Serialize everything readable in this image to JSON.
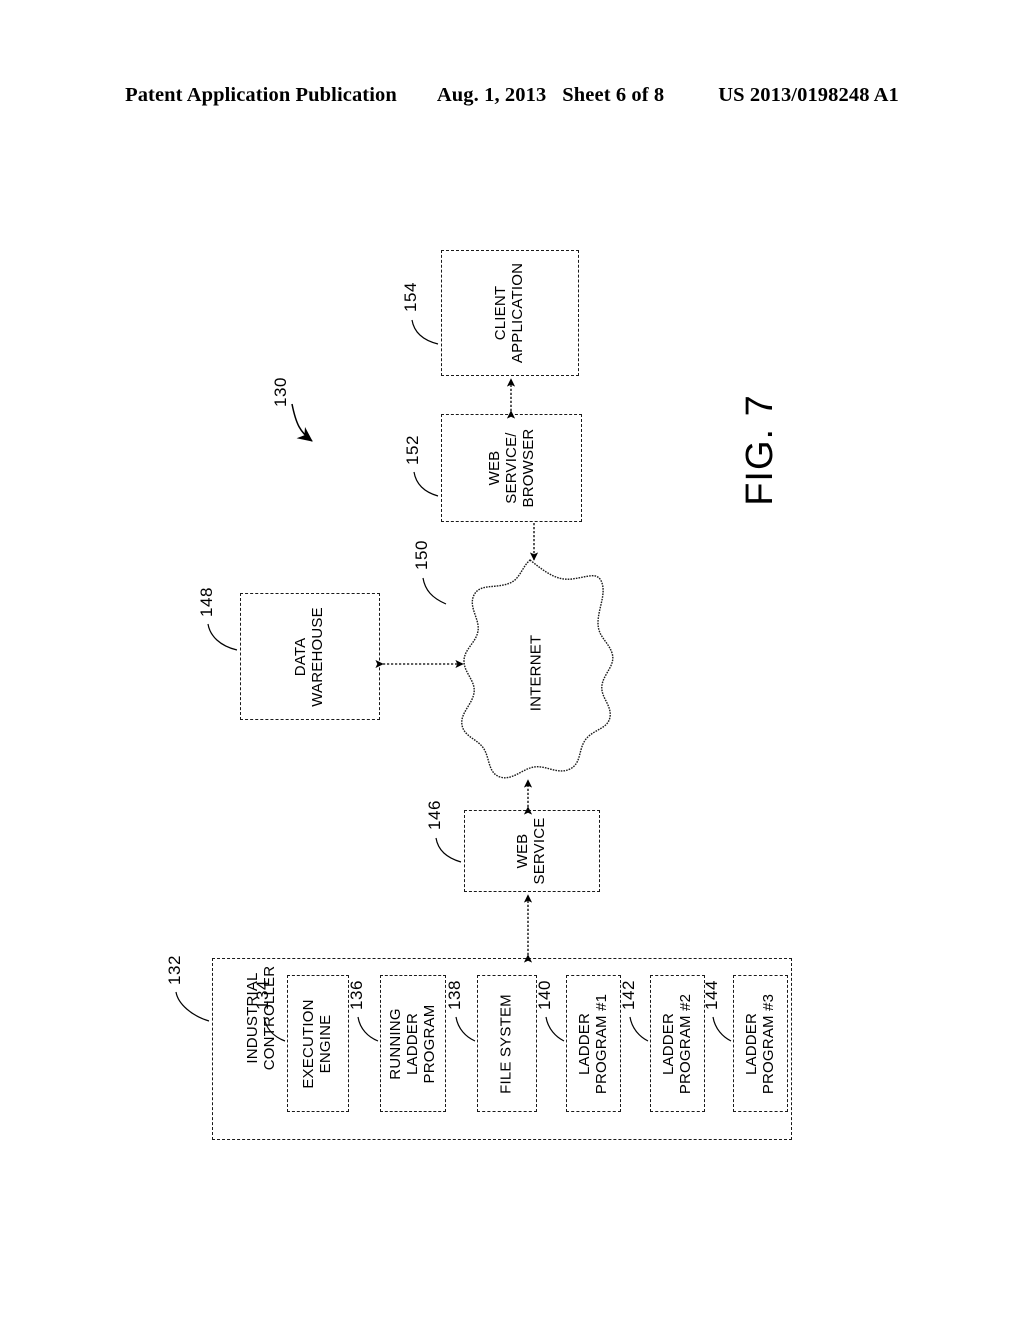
{
  "header": {
    "publication": "Patent Application Publication",
    "date": "Aug. 1, 2013",
    "sheet": "Sheet 6 of 8",
    "number": "US 2013/0198248 A1"
  },
  "figure": {
    "label": "FIG. 7",
    "system_ref": "130"
  },
  "nodes": {
    "client_application": {
      "label": "CLIENT\nAPPLICATION",
      "line1": "CLIENT",
      "line2": "APPLICATION",
      "ref": "154"
    },
    "web_service_browser": {
      "line1": "WEB",
      "line2": "SERVICE/",
      "line3": "BROWSER",
      "ref": "152"
    },
    "internet": {
      "label": "INTERNET",
      "ref": "150"
    },
    "data_warehouse": {
      "line1": "DATA",
      "line2": "WAREHOUSE",
      "ref": "148"
    },
    "web_service": {
      "line1": "WEB",
      "line2": "SERVICE",
      "ref": "146"
    },
    "industrial_controller": {
      "line1": "INDUSTRIAL",
      "line2": "CONTROLLER",
      "ref": "132"
    },
    "execution_engine": {
      "line1": "EXECUTION",
      "line2": "ENGINE",
      "ref": "134"
    },
    "running_ladder_program": {
      "line1": "RUNNING",
      "line2": "LADDER",
      "line3": "PROGRAM",
      "ref": "136"
    },
    "file_system": {
      "line1": "FILE SYSTEM",
      "ref": "138"
    },
    "ladder_program_1": {
      "line1": "LADDER",
      "line2": "PROGRAM #1",
      "ref": "140"
    },
    "ladder_program_2": {
      "line1": "LADDER",
      "line2": "PROGRAM #2",
      "ref": "142"
    },
    "ladder_program_3": {
      "line1": "LADDER",
      "line2": "PROGRAM #3",
      "ref": "144"
    }
  },
  "connections": [
    {
      "from": "web_service_browser",
      "to": "client_application",
      "style": "double-arrow-dashed"
    },
    {
      "from": "web_service_browser",
      "to": "internet",
      "style": "single-arrow-dashed"
    },
    {
      "from": "data_warehouse",
      "to": "internet",
      "style": "double-arrow-dashed"
    },
    {
      "from": "web_service",
      "to": "internet",
      "style": "double-arrow-dashed"
    },
    {
      "from": "industrial_controller",
      "to": "web_service",
      "style": "double-arrow-dashed"
    }
  ],
  "colors": {
    "ink": "#000000",
    "background": "#ffffff",
    "line": "#1a1a1a"
  }
}
